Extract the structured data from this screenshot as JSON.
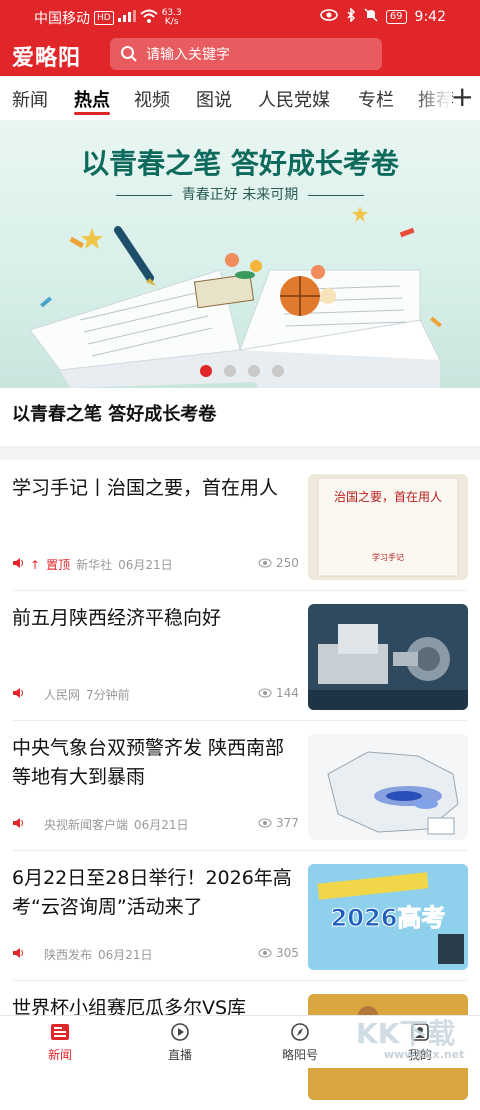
{
  "status_bar": {
    "carrier": "中国移动",
    "hd_badge": "HD",
    "network": "4G",
    "speed_value": "63.3",
    "speed_unit": "K/s",
    "battery": "69",
    "time": "9:42"
  },
  "header": {
    "app_name": "爱略阳",
    "search_placeholder": "请输入关键字"
  },
  "tabs": [
    "新闻",
    "热点",
    "视频",
    "图说",
    "人民党媒",
    "专栏",
    "推荐"
  ],
  "active_tab": "热点",
  "banner": {
    "title": "以青春之笔 答好成长考卷",
    "subtitle": "青春正好 未来可期",
    "caption": "以青春之笔 答好成长考卷",
    "active_dot": 0,
    "dot_count": 4
  },
  "news": [
    {
      "title": "学习手记丨治国之要，首在用人",
      "pinned_label": "置顶",
      "source": "新华社",
      "date": "06月21日",
      "views": "250",
      "thumb_text": "治国之要，首在用人",
      "thumb_tag": "学习手记"
    },
    {
      "title": "前五月陕西经济平稳向好",
      "source": "人民网",
      "date": "7分钟前",
      "views": "144"
    },
    {
      "title": "中央气象台双预警齐发 陕西南部等地有大到暴雨",
      "source": "央视新闻客户端",
      "date": "06月21日",
      "views": "377"
    },
    {
      "title": "6月22日至28日举行！2026年高考“云咨询周”活动来了",
      "source": "陕西发布",
      "date": "06月21日",
      "views": "305",
      "thumb_text": "2026高考"
    },
    {
      "title": "世界杯小组赛厄瓜多尔VS库"
    }
  ],
  "bottom_nav": [
    {
      "label": "新闻",
      "icon": "news-icon",
      "active": true
    },
    {
      "label": "直播",
      "icon": "play-icon"
    },
    {
      "label": "略阳号",
      "icon": "compass-icon"
    },
    {
      "label": "我的",
      "icon": "user-icon"
    }
  ],
  "watermark": {
    "text": "KK下载",
    "url": "www.kkx.net"
  },
  "colors": {
    "brand_red": "#e1262a"
  }
}
